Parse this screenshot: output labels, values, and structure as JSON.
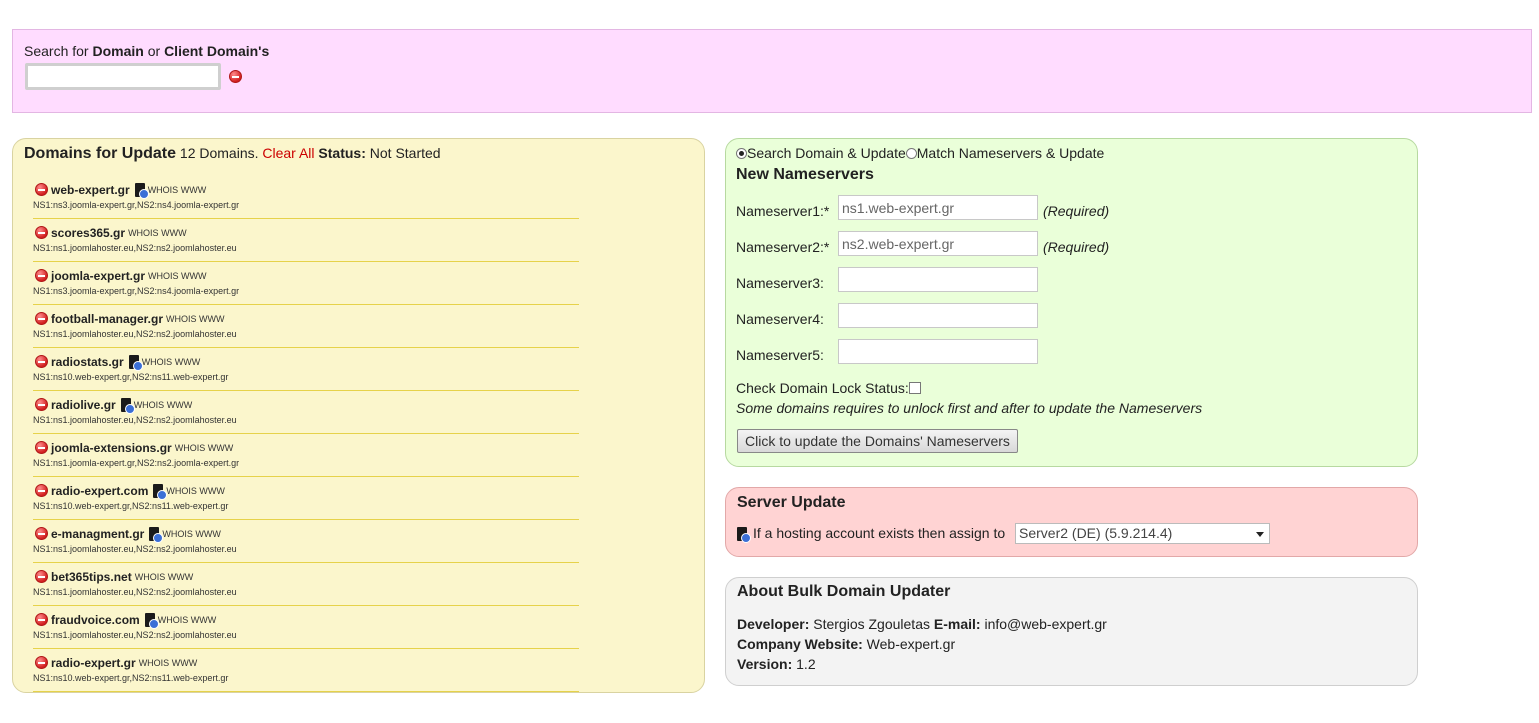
{
  "search": {
    "label_prefix": "Search for",
    "label_domain": "Domain",
    "label_or": "or",
    "label_client": "Client Domain's",
    "value": ""
  },
  "domains_panel": {
    "title": "Domains for Update",
    "count_text": "12 Domains.",
    "clear_all": "Clear All",
    "status_label": "Status:",
    "status_value": "Not Started",
    "whois_label": "WHOIS",
    "www_label": "WWW",
    "items": [
      {
        "name": "web-expert.gr",
        "has_server_icon": true,
        "ns": "NS1:ns3.joomla-expert.gr,NS2:ns4.joomla-expert.gr"
      },
      {
        "name": "scores365.gr",
        "has_server_icon": false,
        "ns": "NS1:ns1.joomlahoster.eu,NS2:ns2.joomlahoster.eu"
      },
      {
        "name": "joomla-expert.gr",
        "has_server_icon": false,
        "ns": "NS1:ns3.joomla-expert.gr,NS2:ns4.joomla-expert.gr"
      },
      {
        "name": "football-manager.gr",
        "has_server_icon": false,
        "ns": "NS1:ns1.joomlahoster.eu,NS2:ns2.joomlahoster.eu"
      },
      {
        "name": "radiostats.gr",
        "has_server_icon": true,
        "ns": "NS1:ns10.web-expert.gr,NS2:ns11.web-expert.gr"
      },
      {
        "name": "radiolive.gr",
        "has_server_icon": true,
        "ns": "NS1:ns1.joomlahoster.eu,NS2:ns2.joomlahoster.eu"
      },
      {
        "name": "joomla-extensions.gr",
        "has_server_icon": false,
        "ns": "NS1:ns1.joomla-expert.gr,NS2:ns2.joomla-expert.gr"
      },
      {
        "name": "radio-expert.com",
        "has_server_icon": true,
        "ns": "NS1:ns10.web-expert.gr,NS2:ns11.web-expert.gr"
      },
      {
        "name": "e-managment.gr",
        "has_server_icon": true,
        "ns": "NS1:ns1.joomlahoster.eu,NS2:ns2.joomlahoster.eu"
      },
      {
        "name": "bet365tips.net",
        "has_server_icon": false,
        "ns": "NS1:ns1.joomlahoster.eu,NS2:ns2.joomlahoster.eu"
      },
      {
        "name": "fraudvoice.com",
        "has_server_icon": true,
        "ns": "NS1:ns1.joomlahoster.eu,NS2:ns2.joomlahoster.eu"
      },
      {
        "name": "radio-expert.gr",
        "has_server_icon": false,
        "ns": "NS1:ns10.web-expert.gr,NS2:ns11.web-expert.gr"
      }
    ]
  },
  "ns_panel": {
    "radio_search": "Search Domain & Update",
    "radio_match": "Match Nameservers & Update",
    "radio_selected": "search",
    "title": "New Nameservers",
    "required_text": "(Required)",
    "fields": [
      {
        "label": "Nameserver1:*",
        "value": "ns1.web-expert.gr",
        "required": true
      },
      {
        "label": "Nameserver2:*",
        "value": "ns2.web-expert.gr",
        "required": true
      },
      {
        "label": "Nameserver3:",
        "value": "",
        "required": false
      },
      {
        "label": "Nameserver4:",
        "value": "",
        "required": false
      },
      {
        "label": "Nameserver5:",
        "value": "",
        "required": false
      }
    ],
    "lock_label": "Check Domain Lock Status:",
    "lock_note": "Some domains requires to unlock first and after to update the Nameservers",
    "update_button": "Click to update the Domains' Nameservers"
  },
  "server_panel": {
    "title": "Server Update",
    "assign_text": "If a hosting account exists then assign to",
    "selected_server": "Server2 (DE) (5.9.214.4)"
  },
  "about_panel": {
    "title": "About Bulk Domain Updater",
    "developer_label": "Developer:",
    "developer_value": "Stergios Zgouletas",
    "email_label": "E-mail:",
    "email_value": "info@web-expert.gr",
    "website_label": "Company Website:",
    "website_value": "Web-expert.gr",
    "version_label": "Version:",
    "version_value": "1.2"
  },
  "colors": {
    "search_bg": "#ffdcff",
    "domains_bg": "#fbf6cc",
    "ns_bg": "#eaffd9",
    "server_bg": "#ffd3d3",
    "about_bg": "#f3f3f3",
    "clear_all": "#cc0000"
  }
}
